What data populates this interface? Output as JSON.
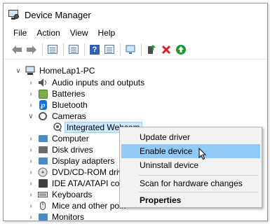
{
  "window": {
    "title": "Device Manager"
  },
  "menubar": {
    "items": [
      "File",
      "Action",
      "View",
      "Help"
    ]
  },
  "tree": {
    "root": "HomeLap1-PC",
    "items": [
      {
        "label": "Audio inputs and outputs",
        "icon": "speaker-icon"
      },
      {
        "label": "Batteries",
        "icon": "battery-icon"
      },
      {
        "label": "Bluetooth",
        "icon": "bluetooth-icon"
      },
      {
        "label": "Cameras",
        "icon": "camera-icon",
        "expanded": true
      },
      {
        "label": "Integrated Webcam",
        "icon": "webcam-icon",
        "child": true,
        "selected": true
      },
      {
        "label": "Computer",
        "icon": "computer-icon"
      },
      {
        "label": "Disk drives",
        "icon": "disk-drive-icon"
      },
      {
        "label": "Display adapters",
        "icon": "display-adapter-icon"
      },
      {
        "label": "DVD/CD-ROM drive",
        "icon": "dvd-drive-icon"
      },
      {
        "label": "IDE ATA/ATAPI cont",
        "icon": "ide-controller-icon"
      },
      {
        "label": "Keyboards",
        "icon": "keyboard-icon"
      },
      {
        "label": "Mice and other poin",
        "icon": "mouse-icon"
      },
      {
        "label": "Monitors",
        "icon": "monitor-icon"
      }
    ]
  },
  "context_menu": {
    "items": [
      "Update driver",
      "Enable device",
      "Uninstall device",
      "Scan for hardware changes",
      "Properties"
    ],
    "highlighted": "Enable device"
  },
  "colors": {
    "accent": "#91c9f7",
    "selection": "#cce8ff",
    "enable_green": "#1a9a37",
    "remove_red": "#d32020"
  }
}
